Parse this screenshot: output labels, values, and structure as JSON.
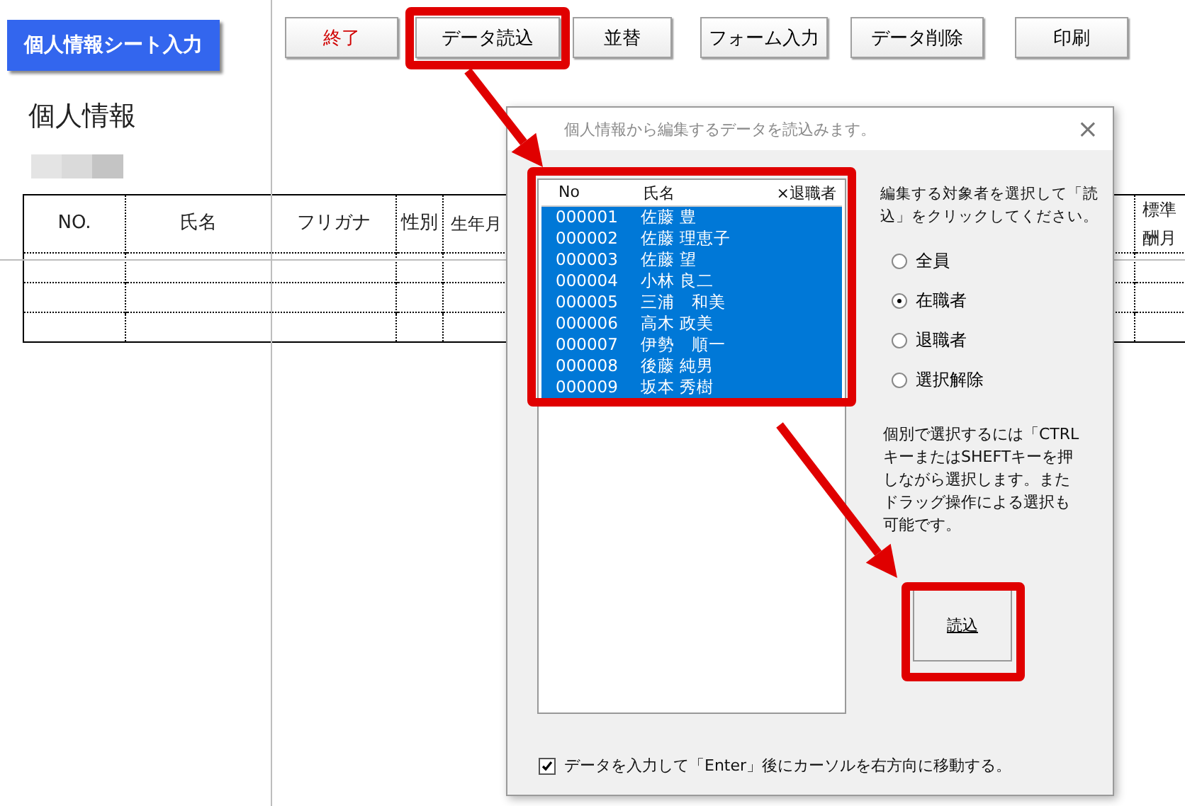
{
  "sheet": {
    "title_button": "個人情報シート入力",
    "toolbar": [
      {
        "label": "終了",
        "kind": "exit"
      },
      {
        "label": "データ読込",
        "kind": "normal"
      },
      {
        "label": "並替",
        "kind": "normal"
      },
      {
        "label": "フォーム入力",
        "kind": "normal"
      },
      {
        "label": "データ削除",
        "kind": "normal"
      },
      {
        "label": "印刷",
        "kind": "normal"
      }
    ],
    "heading": "個人情報",
    "table": {
      "columns": [
        {
          "lines": [
            "NO."
          ]
        },
        {
          "lines": [
            "氏名"
          ]
        },
        {
          "lines": [
            "フリガナ"
          ]
        },
        {
          "lines": [
            "性別"
          ]
        },
        {
          "lines": [
            "生年月"
          ]
        },
        {
          "lines": [
            "標準",
            "酬月"
          ]
        }
      ]
    }
  },
  "dialog": {
    "title": "個人情報から編集するデータを読込みます。",
    "close": "×",
    "list": {
      "columns": [
        "No",
        "氏名",
        "×退職者"
      ],
      "rows": [
        {
          "no": "000001",
          "name": "佐藤 豊",
          "selected": true
        },
        {
          "no": "000002",
          "name": "佐藤 理恵子",
          "selected": true
        },
        {
          "no": "000003",
          "name": "佐藤 望",
          "selected": true
        },
        {
          "no": "000004",
          "name": "小林 良二",
          "selected": true
        },
        {
          "no": "000005",
          "name": "三浦　和美",
          "selected": true
        },
        {
          "no": "000006",
          "name": "高木 政美",
          "selected": true
        },
        {
          "no": "000007",
          "name": "伊勢　順一",
          "selected": true
        },
        {
          "no": "000008",
          "name": "後藤 純男",
          "selected": true
        },
        {
          "no": "000009",
          "name": "坂本 秀樹",
          "selected": true
        }
      ]
    },
    "instruction": "編集する対象者を選択して「読込」をクリックしてください。",
    "radios": [
      {
        "label": "全員",
        "selected": false
      },
      {
        "label": "在職者",
        "selected": true
      },
      {
        "label": "退職者",
        "selected": false
      },
      {
        "label": "選択解除",
        "selected": false
      }
    ],
    "note": "個別で選択するには「CTRLキーまたはSHEFTキーを押しながら選択します。またドラッグ操作による選択も可能です。",
    "load_button": "読込",
    "checkbox": {
      "label": "データを入力して「Enter」後にカーソルを右方向に移動する。",
      "checked": true
    }
  }
}
